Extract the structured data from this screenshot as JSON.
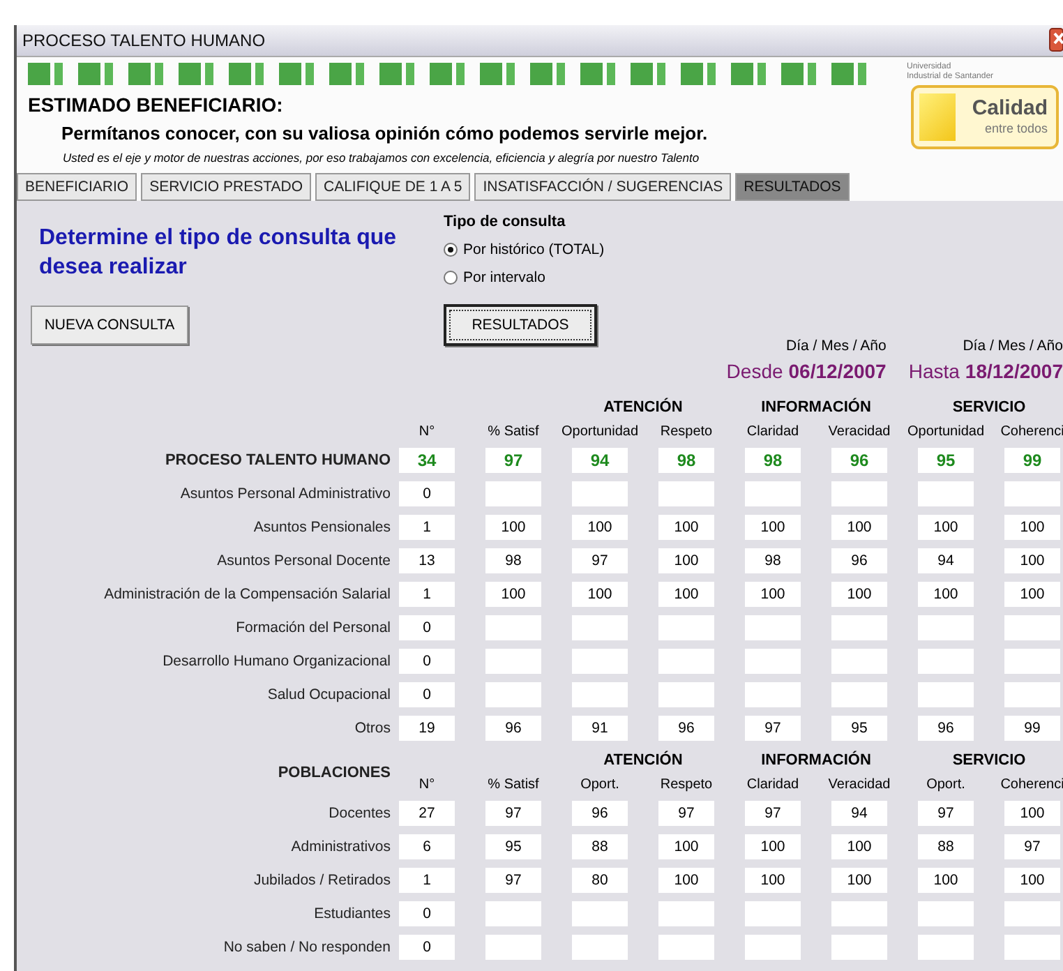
{
  "window": {
    "title": "PROCESO TALENTO HUMANO"
  },
  "header": {
    "heading": "ESTIMADO BENEFICIARIO:",
    "subheading": "Permítanos conocer, con su valiosa opinión cómo podemos servirle mejor.",
    "tagline": "Usted es el eje y motor de nuestras acciones, por eso trabajamos con excelencia, eficiencia y alegría por nuestro Talento"
  },
  "logo": {
    "university": [
      "Universidad",
      "Industrial de Santander"
    ],
    "title": "Calidad",
    "subtitle": "entre todos"
  },
  "tabs": [
    {
      "label": "BENEFICIARIO",
      "selected": false
    },
    {
      "label": "SERVICIO PRESTADO",
      "selected": false
    },
    {
      "label": "CALIFIQUE DE 1 A 5",
      "selected": false
    },
    {
      "label": "INSATISFACCIÓN / SUGERENCIAS",
      "selected": false
    },
    {
      "label": "RESULTADOS",
      "selected": true
    }
  ],
  "query": {
    "prompt": "Determine el tipo de consulta que desea realizar",
    "type_label": "Tipo de consulta",
    "options": [
      {
        "label": "Por histórico (TOTAL)",
        "selected": true
      },
      {
        "label": "Por intervalo",
        "selected": false
      }
    ],
    "new_button": "NUEVA CONSULTA",
    "results_button": "RESULTADOS",
    "dates": [
      {
        "format": "Día / Mes / Año",
        "label": "Desde",
        "value": "06/12/2007"
      },
      {
        "format": "Día / Mes / Año",
        "label": "Hasta",
        "value": "18/12/2007"
      }
    ]
  },
  "tables": [
    {
      "title": "PROCESO TALENTO HUMANO",
      "groups": [
        "ATENCIÓN",
        "INFORMACIÓN",
        "SERVICIO"
      ],
      "columns": [
        "N°",
        "% Satisf",
        "Oportunidad",
        "Respeto",
        "Claridad",
        "Veracidad",
        "Oportunidad",
        "Coherenci"
      ],
      "total": [
        "34",
        "97",
        "94",
        "98",
        "98",
        "96",
        "95",
        "99"
      ],
      "rows": [
        {
          "label": "Asuntos Personal Administrativo",
          "values": [
            "0"
          ]
        },
        {
          "label": "Asuntos Pensionales",
          "values": [
            "1",
            "100",
            "100",
            "100",
            "100",
            "100",
            "100",
            "100"
          ]
        },
        {
          "label": "Asuntos Personal Docente",
          "values": [
            "13",
            "98",
            "97",
            "100",
            "98",
            "96",
            "94",
            "100"
          ]
        },
        {
          "label": "Administración de la Compensación Salarial",
          "values": [
            "1",
            "100",
            "100",
            "100",
            "100",
            "100",
            "100",
            "100"
          ]
        },
        {
          "label": "Formación del Personal",
          "values": [
            "0"
          ]
        },
        {
          "label": "Desarrollo Humano Organizacional",
          "values": [
            "0"
          ]
        },
        {
          "label": "Salud Ocupacional",
          "values": [
            "0"
          ]
        },
        {
          "label": "Otros",
          "values": [
            "19",
            "96",
            "91",
            "96",
            "97",
            "95",
            "96",
            "99"
          ]
        }
      ]
    },
    {
      "title": "POBLACIONES",
      "groups": [
        "ATENCIÓN",
        "INFORMACIÓN",
        "SERVICIO"
      ],
      "columns": [
        "N°",
        "% Satisf",
        "Oport.",
        "Respeto",
        "Claridad",
        "Veracidad",
        "Oport.",
        "Coherenci"
      ],
      "rows": [
        {
          "label": "Docentes",
          "values": [
            "27",
            "97",
            "96",
            "97",
            "97",
            "94",
            "97",
            "100"
          ]
        },
        {
          "label": "Administrativos",
          "values": [
            "6",
            "95",
            "88",
            "100",
            "100",
            "100",
            "88",
            "97"
          ]
        },
        {
          "label": "Jubilados / Retirados",
          "values": [
            "1",
            "97",
            "80",
            "100",
            "100",
            "100",
            "100",
            "100"
          ]
        },
        {
          "label": "Estudiantes",
          "values": [
            "0"
          ]
        },
        {
          "label": "No saben / No responden",
          "values": [
            "0"
          ]
        }
      ]
    }
  ]
}
